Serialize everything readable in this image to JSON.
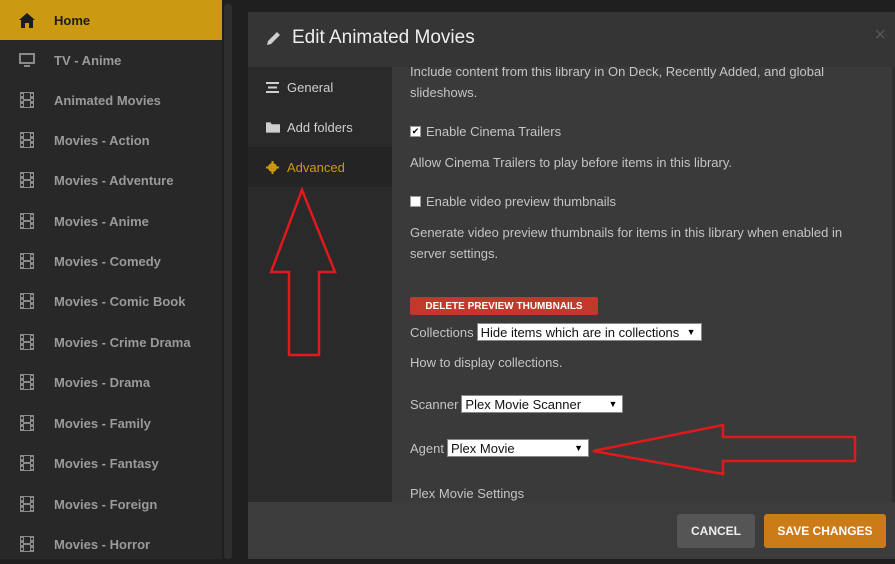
{
  "sidebar": {
    "items": [
      {
        "label": "Home",
        "icon": "home-icon"
      },
      {
        "label": "TV - Anime",
        "icon": "tv-icon"
      },
      {
        "label": "Animated Movies",
        "icon": "film-icon"
      },
      {
        "label": "Movies - Action",
        "icon": "film-icon"
      },
      {
        "label": "Movies - Adventure",
        "icon": "film-icon"
      },
      {
        "label": "Movies - Anime",
        "icon": "film-icon"
      },
      {
        "label": "Movies - Comedy",
        "icon": "film-icon"
      },
      {
        "label": "Movies - Comic Book",
        "icon": "film-icon"
      },
      {
        "label": "Movies - Crime Drama",
        "icon": "film-icon"
      },
      {
        "label": "Movies - Drama",
        "icon": "film-icon"
      },
      {
        "label": "Movies - Family",
        "icon": "film-icon"
      },
      {
        "label": "Movies - Fantasy",
        "icon": "film-icon"
      },
      {
        "label": "Movies - Foreign",
        "icon": "film-icon"
      },
      {
        "label": "Movies - Horror",
        "icon": "film-icon"
      }
    ],
    "active_index": 0
  },
  "modal": {
    "title": "Edit Animated Movies",
    "close": "×",
    "nav": [
      {
        "label": "General",
        "icon": "lines-icon"
      },
      {
        "label": "Add folders",
        "icon": "folder-icon"
      },
      {
        "label": "Advanced",
        "icon": "gear-icon"
      }
    ],
    "active_nav_index": 2
  },
  "advanced": {
    "on_deck_help_line1": "Include content from this library in On Deck, Recently Added, and global",
    "on_deck_help_line2": "slideshows.",
    "cinema_trailers_label": "Enable Cinema Trailers",
    "cinema_trailers_checked": true,
    "cinema_trailers_help": "Allow Cinema Trailers to play before items in this library.",
    "video_preview_label": "Enable video preview thumbnails",
    "video_preview_checked": false,
    "video_preview_help_line1": "Generate video preview thumbnails for items in this library when enabled in",
    "video_preview_help_line2": "server settings.",
    "delete_thumbnails_button": "DELETE PREVIEW THUMBNAILS",
    "collections_label": "Collections",
    "collections_value": "Hide items which are in collections",
    "collections_help": "How to display collections.",
    "scanner_label": "Scanner",
    "scanner_value": "Plex Movie Scanner",
    "agent_label": "Agent",
    "agent_value": "Plex Movie",
    "agent_settings_heading": "Plex Movie Settings"
  },
  "footer": {
    "cancel_label": "CANCEL",
    "save_label": "SAVE CHANGES"
  },
  "colors": {
    "accent": "#cc9a10",
    "save": "#cc7b19",
    "danger": "#c0392b",
    "annotation_arrow": "#e0191c"
  }
}
